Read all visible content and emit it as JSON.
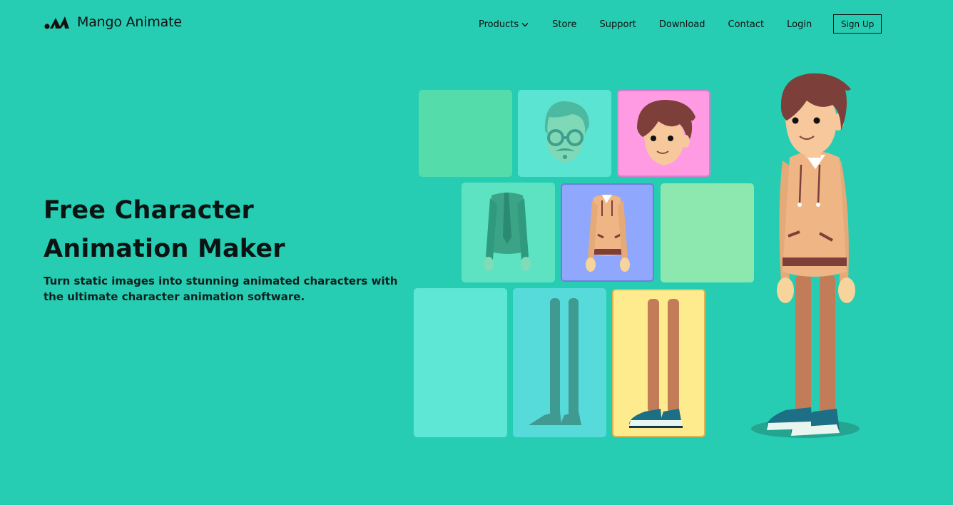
{
  "brand": {
    "name": "Mango Animate",
    "logo_icon": "mango-logo-icon"
  },
  "nav": {
    "products": "Products",
    "store": "Store",
    "support": "Support",
    "download": "Download",
    "contact": "Contact",
    "login": "Login",
    "signup": "Sign Up"
  },
  "hero": {
    "title": "Free Character Animation Maker",
    "subtitle": "Turn static images into stunning animated characters with the ultimate character animation software."
  },
  "colors": {
    "background": "#27cdb3",
    "text": "#0b1412"
  }
}
